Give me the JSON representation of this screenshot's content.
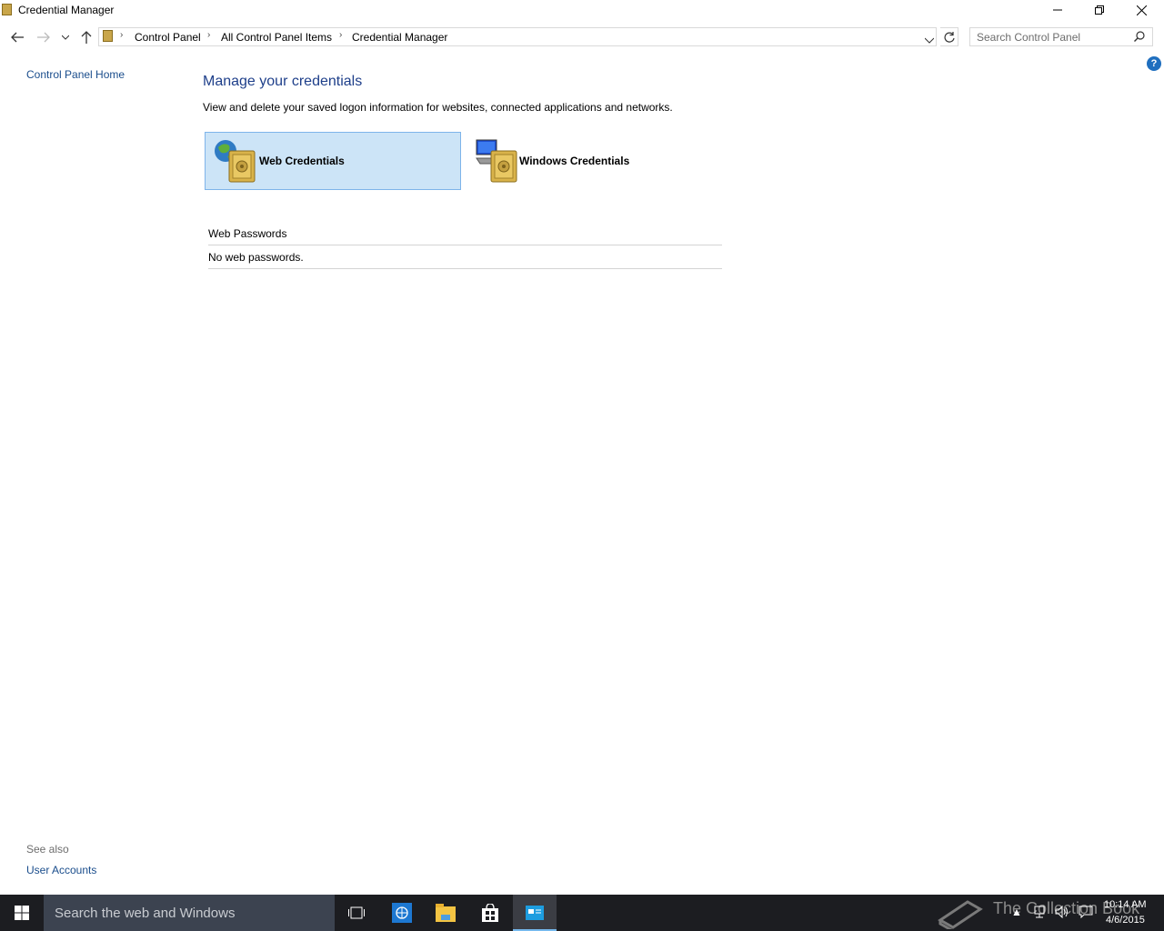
{
  "window": {
    "title": "Credential Manager",
    "controls": {
      "minimize": "minimize",
      "maximize": "restore",
      "close": "close"
    }
  },
  "address": {
    "breadcrumb": [
      "Control Panel",
      "All Control Panel Items",
      "Credential Manager"
    ]
  },
  "search": {
    "placeholder": "Search Control Panel"
  },
  "sidebar": {
    "home_link": "Control Panel Home",
    "see_also_label": "See also",
    "see_also_links": [
      "User Accounts"
    ]
  },
  "main": {
    "title": "Manage your credentials",
    "description": "View and delete your saved logon information for websites, connected applications and networks.",
    "tiles": [
      {
        "label": "Web Credentials",
        "icon": "globe-vault-icon",
        "selected": true
      },
      {
        "label": "Windows Credentials",
        "icon": "computer-vault-icon",
        "selected": false
      }
    ],
    "section_header": "Web Passwords",
    "empty_message": "No web passwords."
  },
  "taskbar": {
    "search_text": "Search the web and Windows",
    "pinned": [
      "task-view-icon",
      "internet-explorer-icon",
      "file-explorer-icon",
      "store-icon",
      "credential-manager-icon"
    ],
    "watermark": "The Collection Book",
    "clock": {
      "time": "10:14 AM",
      "date": "4/6/2015"
    }
  },
  "colors": {
    "title_blue": "#1e3f8a",
    "link_blue": "#1a4d8c",
    "tile_selected_bg": "#cce4f7",
    "tile_selected_border": "#7eb4ea",
    "taskbar_bg": "#1c1d21",
    "taskbar_search_bg": "#3c4350"
  }
}
